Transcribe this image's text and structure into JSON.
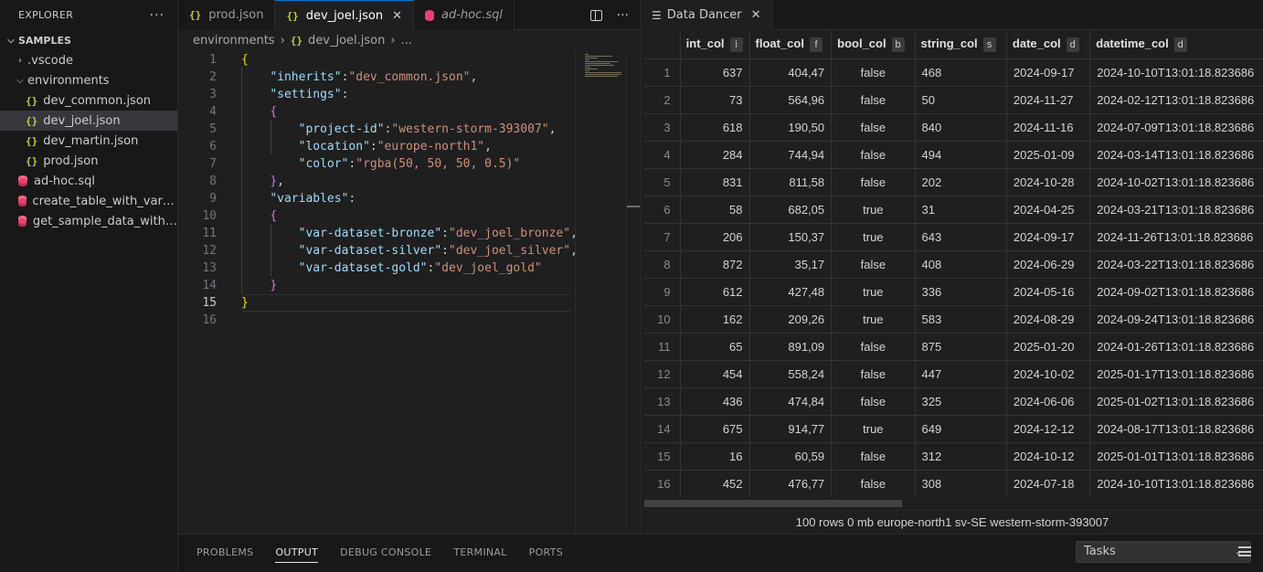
{
  "explorer": {
    "title": "EXPLORER",
    "more": "···",
    "root": "SAMPLES",
    "items": [
      {
        "label": ".vscode",
        "kind": "folder",
        "expanded": false
      },
      {
        "label": "environments",
        "kind": "folder",
        "expanded": true
      },
      {
        "label": "dev_common.json",
        "kind": "json"
      },
      {
        "label": "dev_joel.json",
        "kind": "json",
        "active": true
      },
      {
        "label": "dev_martin.json",
        "kind": "json"
      },
      {
        "label": "prod.json",
        "kind": "json"
      },
      {
        "label": "ad-hoc.sql",
        "kind": "sql"
      },
      {
        "label": "create_table_with_variable...",
        "kind": "sql"
      },
      {
        "label": "get_sample_data_with_co...",
        "kind": "sql"
      }
    ]
  },
  "editor": {
    "tabs": [
      {
        "label": "prod.json",
        "icon": "json-icon"
      },
      {
        "label": "dev_joel.json",
        "icon": "json-icon",
        "active": true,
        "close": "✕"
      },
      {
        "label": "ad-hoc.sql",
        "icon": "database-icon",
        "italic": true
      }
    ],
    "more": "···",
    "breadcrumb": {
      "folder": "environments",
      "file": "dev_joel.json",
      "tail": "..."
    },
    "current_line": 15,
    "lines": [
      "{",
      "    \"inherits\":\"dev_common.json\",",
      "    \"settings\":",
      "    {",
      "        \"project-id\":\"western-storm-393007\",",
      "        \"location\":\"europe-north1\",",
      "        \"color\":\"rgba(50, 50, 50, 0.5)\"",
      "    },",
      "    \"variables\":",
      "    {",
      "        \"var-dataset-bronze\":\"dev_joel_bronze\",",
      "        \"var-dataset-silver\":\"dev_joel_silver\",",
      "        \"var-dataset-gold\":\"dev_joel_gold\"",
      "    }",
      "}",
      ""
    ]
  },
  "dancer": {
    "tab_label": "Data Dancer",
    "close": "✕",
    "columns": [
      {
        "name": "int_col",
        "type": "i"
      },
      {
        "name": "float_col",
        "type": "f"
      },
      {
        "name": "bool_col",
        "type": "b"
      },
      {
        "name": "string_col",
        "type": "s"
      },
      {
        "name": "date_col",
        "type": "d"
      },
      {
        "name": "datetime_col",
        "type": "d"
      }
    ],
    "rows": [
      [
        "1",
        "637",
        "404,47",
        "false",
        "468",
        "2024-09-17",
        "2024-10-10T13:01:18.823686"
      ],
      [
        "2",
        "73",
        "564,96",
        "false",
        "50",
        "2024-11-27",
        "2024-02-12T13:01:18.823686"
      ],
      [
        "3",
        "618",
        "190,50",
        "false",
        "840",
        "2024-11-16",
        "2024-07-09T13:01:18.823686"
      ],
      [
        "4",
        "284",
        "744,94",
        "false",
        "494",
        "2025-01-09",
        "2024-03-14T13:01:18.823686"
      ],
      [
        "5",
        "831",
        "811,58",
        "false",
        "202",
        "2024-10-28",
        "2024-10-02T13:01:18.823686"
      ],
      [
        "6",
        "58",
        "682,05",
        "true",
        "31",
        "2024-04-25",
        "2024-03-21T13:01:18.823686"
      ],
      [
        "7",
        "206",
        "150,37",
        "true",
        "643",
        "2024-09-17",
        "2024-11-26T13:01:18.823686"
      ],
      [
        "8",
        "872",
        "35,17",
        "false",
        "408",
        "2024-06-29",
        "2024-03-22T13:01:18.823686"
      ],
      [
        "9",
        "612",
        "427,48",
        "true",
        "336",
        "2024-05-16",
        "2024-09-02T13:01:18.823686"
      ],
      [
        "10",
        "162",
        "209,26",
        "true",
        "583",
        "2024-08-29",
        "2024-09-24T13:01:18.823686"
      ],
      [
        "11",
        "65",
        "891,09",
        "false",
        "875",
        "2025-01-20",
        "2024-01-26T13:01:18.823686"
      ],
      [
        "12",
        "454",
        "558,24",
        "false",
        "447",
        "2024-10-02",
        "2025-01-17T13:01:18.823686"
      ],
      [
        "13",
        "436",
        "474,84",
        "false",
        "325",
        "2024-06-06",
        "2025-01-02T13:01:18.823686"
      ],
      [
        "14",
        "675",
        "914,77",
        "true",
        "649",
        "2024-12-12",
        "2024-08-17T13:01:18.823686"
      ],
      [
        "15",
        "16",
        "60,59",
        "false",
        "312",
        "2024-10-12",
        "2025-01-01T13:01:18.823686"
      ],
      [
        "16",
        "452",
        "476,77",
        "false",
        "308",
        "2024-07-18",
        "2024-10-10T13:01:18.823686"
      ]
    ],
    "status": "100 rows 0 mb europe-north1 sv-SE western-storm-393007"
  },
  "panel": {
    "tabs": [
      "PROBLEMS",
      "OUTPUT",
      "DEBUG CONSOLE",
      "TERMINAL",
      "PORTS"
    ],
    "active_tab": "OUTPUT",
    "task_select": "Tasks"
  }
}
